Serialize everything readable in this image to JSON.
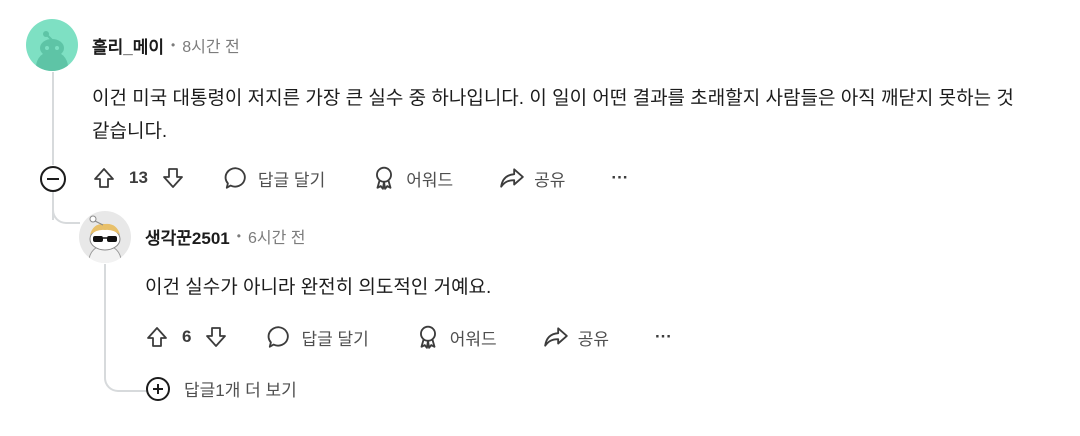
{
  "comments": [
    {
      "username": "홀리_메이",
      "time": "8시간 전",
      "body": "이건 미국 대통령이 저지른 가장 큰 실수 중 하나입니다. 이 일이 어떤 결과를 초래할지 사람들은 아직 깨닫지 못하는 것 같습니다.",
      "votes": "13",
      "reply_label": "답글 달기",
      "award_label": "어워드",
      "share_label": "공유",
      "more_label": "···"
    },
    {
      "username": "생각꾼2501",
      "time": "6시간 전",
      "body": "이건 실수가 아니라 완전히 의도적인 거예요.",
      "votes": "6",
      "reply_label": "답글 달기",
      "award_label": "어워드",
      "share_label": "공유",
      "more_label": "···"
    }
  ],
  "more_replies_label": "답글1개 더 보기",
  "colors": {
    "avatar1_bg": "#7ee0c3",
    "text": "#1c1c1c",
    "muted": "#7c7c7c"
  }
}
